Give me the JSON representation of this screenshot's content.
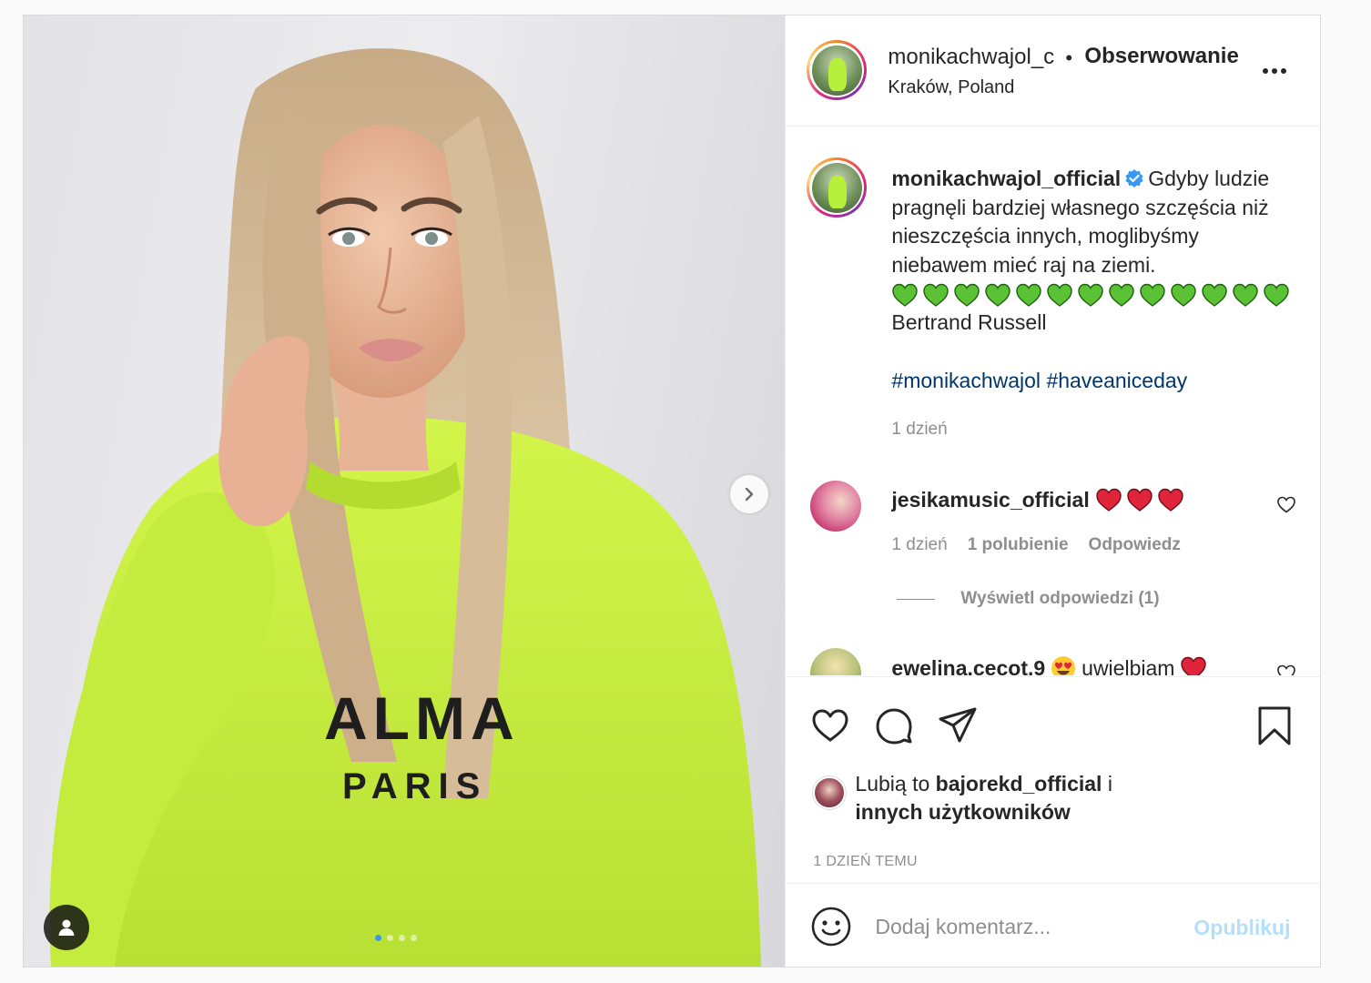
{
  "post": {
    "author": "monikachwajol_c",
    "separator": "•",
    "follow_label": "Obserwowanie",
    "location": "Kraków, Poland"
  },
  "photo": {
    "carousel_dots": 4,
    "active_dot": 0
  },
  "caption": {
    "username": "monikachwajol_official",
    "text": "Gdyby ludzie pragnęli bardziej własnego szczęścia niż nieszczęścia innych, moglibyśmy niebawem mieć raj na ziemi.",
    "green_hearts": 13,
    "quote_author": "Bertrand Russell",
    "hashtags": [
      "#monikachwajol",
      "#haveaniceday"
    ],
    "time": "1 dzień"
  },
  "comments": [
    {
      "username": "jesikamusic_official",
      "red_hearts": 3,
      "time": "1 dzień",
      "likes": "1 polubienie",
      "reply_label": "Odpowiedz",
      "view_replies": "Wyświetl odpowiedzi (1)"
    },
    {
      "username": "ewelina.cecot.9",
      "text": "uwielbiam"
    }
  ],
  "likes": {
    "prefix": "Lubią to",
    "user": "bajorekd_official",
    "conj": "i",
    "others": "innych użytkowników"
  },
  "post_time": "1 DZIEŃ TEMU",
  "add_comment": {
    "placeholder": "Dodaj komentarz...",
    "publish_label": "Opublikuj"
  },
  "colors": {
    "accent_blue": "#3897f0",
    "hashtag": "#00376b",
    "muted": "#8e8e8e",
    "publish_disabled": "#b2dffc",
    "sweater": "#c6f03c"
  },
  "icons": [
    "chevron-right-icon",
    "user-tag-icon",
    "more-icon",
    "verified-icon",
    "heart-icon",
    "comment-icon",
    "share-icon",
    "bookmark-icon",
    "emoji-icon"
  ]
}
